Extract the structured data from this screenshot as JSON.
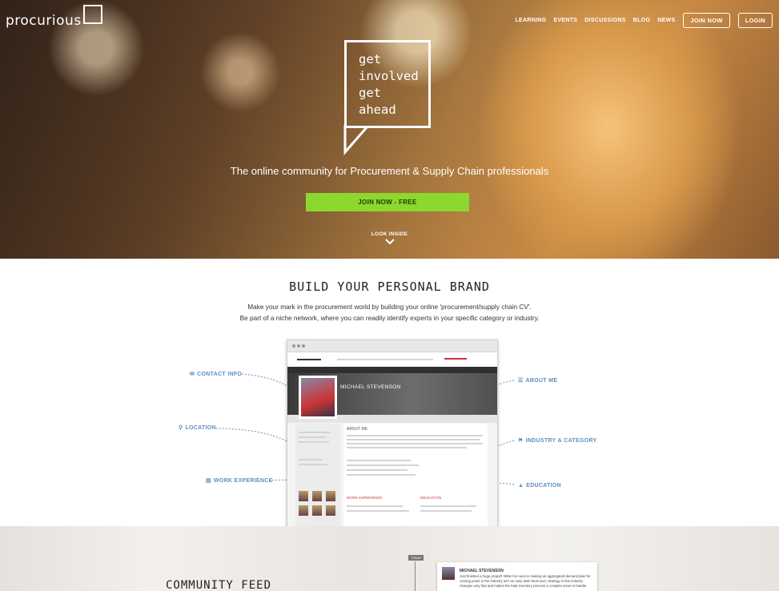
{
  "header": {
    "logo_text": "procurious",
    "nav": [
      "LEARNING",
      "EVENTS",
      "DISCUSSIONS",
      "BLOG",
      "NEWS"
    ],
    "join_label": "JOIN NOW",
    "login_label": "LOGIN"
  },
  "hero": {
    "bubble_lines": [
      "get",
      "involved",
      "get",
      "ahead"
    ],
    "tagline": "The online community for Procurement & Supply Chain professionals",
    "cta_label": "JOIN NOW - FREE",
    "look_inside": "LOOK INSIDE"
  },
  "brand": {
    "title": "BUILD YOUR PERSONAL BRAND",
    "line1": "Make your mark in the procurement world by building your online 'procurement/supply chain CV'.",
    "line2": "Be part of a niche network, where you can readily identify experts in your specific category or industry."
  },
  "mockup": {
    "profile_name": "MICHAEL STEVENSON",
    "about_heading": "ABOUT ME",
    "work_heading": "WORK EXPERIENCE",
    "education_heading": "EDUCATION"
  },
  "callouts": {
    "contact_info": "CONTACT INFO",
    "location": "LOCATION",
    "work_experience": "WORK EXPERIENCE",
    "about_me": "ABOUT ME",
    "industry_category": "INDUSTRY & CATEGORY",
    "education": "EDUCATION"
  },
  "feed": {
    "title": "COMMUNITY FEED",
    "today_label": "TODAY",
    "card_name": "MICHAEL STEVENSON",
    "card_text": "Just finished a huge project! What I've seen is making an aggregated demand plan for coming years in the industry isn't an easy task! Moreover, strategy in this industry changes very fast and makes the total inventory process a complex issue to handle."
  },
  "colors": {
    "cta_green": "#8cd82f",
    "callout_blue": "#5b8fbf"
  },
  "icons": [
    "envelope-icon",
    "map-pin-icon",
    "briefcase-icon",
    "list-icon",
    "tags-icon",
    "graduation-cap-icon",
    "chevron-down-icon"
  ]
}
